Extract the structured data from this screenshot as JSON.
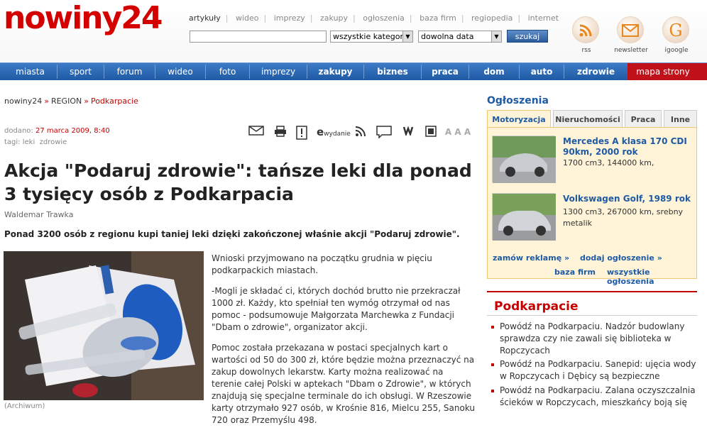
{
  "logo": {
    "text": "nowiny24"
  },
  "top_tabs": [
    "artykuły",
    "wideo",
    "imprezy",
    "zakupy",
    "ogłoszenia",
    "baza firm",
    "regiopedia",
    "internet"
  ],
  "search": {
    "placeholder": "",
    "category": "wszystkie kategorie",
    "date": "dowolna data",
    "button": "szukaj"
  },
  "header_icons": [
    {
      "label": "rss",
      "icon": "rss-icon"
    },
    {
      "label": "newsletter",
      "icon": "envelope-icon"
    },
    {
      "label": "igoogle",
      "icon": "google-icon"
    }
  ],
  "nav": [
    "miasta",
    "sport",
    "forum",
    "wideo",
    "foto",
    "imprezy",
    "zakupy",
    "biznes",
    "praca",
    "dom",
    "auto",
    "zdrowie",
    "mapa strony"
  ],
  "breadcrumb": {
    "a": "nowiny24",
    "b": "REGION",
    "c": "Podkarpacie"
  },
  "meta": {
    "added_label": "dodano:",
    "added_value": "27 marca 2009, 8:40",
    "tags_label": "tagi:",
    "tag1": "leki",
    "tag2": "zdrowie"
  },
  "toolbar": {
    "ewydanie": "wydanie",
    "font": "A A A"
  },
  "article": {
    "title": "Akcja \"Podaruj zdrowie\": tańsze leki dla ponad 3 tysięcy osób z Podkarpacia",
    "author": "Waldemar Trawka",
    "lead": "Ponad 3200 osób z regionu kupi taniej leki dzięki zakończonej właśnie akcji \"Podaruj zdrowie\".",
    "caption": "(Archiwum)",
    "p1": "Wnioski przyjmowano na początku grudnia w pięciu podkarpackich miastach.",
    "p2": "-Mogli je składać ci, których dochód brutto nie przekraczał 1000 zł. Każdy, kto spełniał ten wymóg otrzymał od nas pomoc - podsumowuje Małgorzata Marchewka z Fundacji \"Dbam o zdrowie\", organizator akcji.",
    "p3": "Pomoc została przekazana w postaci specjalnych kart o wartości od 50 do 300 zł, które będzie można przeznaczyć na zakup dowolnych lekarstw. Karty można realizować na terenie całej Polski w aptekach \"Dbam o Zdrowie\", w których znajdują się specjalne terminale do ich obsługi. W Rzeszowie karty otrzymało 927 osób, w Krośnie 816, Mielcu 255, Sanoku 720 oraz Przemyślu 498."
  },
  "ads": {
    "heading": "Ogłoszenia",
    "tabs": [
      "Motoryzacja",
      "Nieruchomości",
      "Praca",
      "Inne"
    ],
    "items": [
      {
        "title": "Mercedes A klasa 170 CDI 90km, 2000 rok",
        "desc": "1700 cm3, 144000 km,"
      },
      {
        "title": "Volkswagen Golf, 1989 rok",
        "desc": "1300 cm3, 267000 km, srebny metalik"
      }
    ],
    "link_advertise": "zamów reklamę »",
    "link_add": "dodaj ogłoszenie »",
    "link_firms": "baza firm",
    "link_all": "wszystkie ogłoszenia"
  },
  "region": {
    "heading": "Podkarpacie",
    "items": [
      "Powódź na Podkarpaciu. Nadzór budowlany sprawdza czy nie zawali się biblioteka w Ropczycach",
      "Powódź na Podkarpaciu. Sanepid: ujęcia wody w Ropczycach i Dębicy są bezpieczne",
      "Powódź na Podkarpaciu. Zalana oczyszczalnia ścieków w Ropczycach, mieszkańcy boją się"
    ]
  }
}
